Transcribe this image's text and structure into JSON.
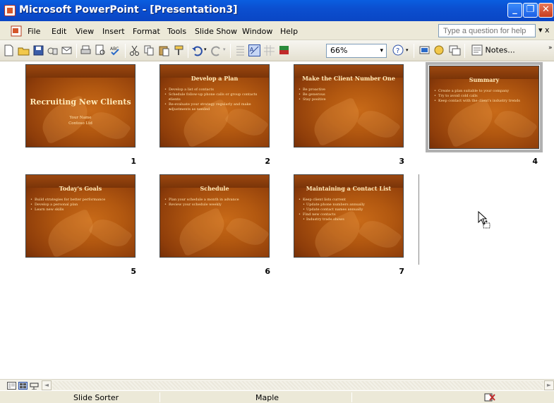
{
  "window": {
    "title": "Microsoft PowerPoint - [Presentation3]"
  },
  "menu": {
    "items": [
      "File",
      "Edit",
      "View",
      "Insert",
      "Format",
      "Tools",
      "Slide Show",
      "Window",
      "Help"
    ],
    "help_placeholder": "Type a question for help",
    "close_doc": "x"
  },
  "toolbar": {
    "zoom": "66%",
    "notes_label": "Notes..."
  },
  "slides": [
    {
      "number": "1",
      "title": "Recruiting New Clients",
      "subtitle": [
        "Your Name",
        "Contoso Ltd"
      ],
      "bullets": []
    },
    {
      "number": "2",
      "title": "Develop a Plan",
      "bullets": [
        {
          "text": "Develop a list of contacts",
          "level": 1
        },
        {
          "text": "Schedule follow-up phone calls or group contacts",
          "level": 1
        },
        {
          "text": "clients",
          "level": 2
        },
        {
          "text": "Re-evaluate your strategy regularly and make",
          "level": 1
        },
        {
          "text": "adjustments as needed",
          "level": 2
        }
      ]
    },
    {
      "number": "3",
      "title": "Make the Client Number One",
      "bullets": [
        {
          "text": "Be proactive",
          "level": 1
        },
        {
          "text": "Be generous",
          "level": 1
        },
        {
          "text": "Stay positive",
          "level": 1
        }
      ]
    },
    {
      "number": "4",
      "title": "Summary",
      "bullets": [
        {
          "text": "Create a plan suitable to your company",
          "level": 1
        },
        {
          "text": "Try to avoid cold calls",
          "level": 1
        },
        {
          "text": "Keep contact with the client's industry trends",
          "level": 1
        }
      ]
    },
    {
      "number": "5",
      "title": "Today's Goals",
      "bullets": [
        {
          "text": "Build strategies for better performance",
          "level": 1
        },
        {
          "text": "Develop a personal plan",
          "level": 1
        },
        {
          "text": "Learn new skills",
          "level": 1
        }
      ]
    },
    {
      "number": "6",
      "title": "Schedule",
      "bullets": [
        {
          "text": "Plan your schedule a month in advance",
          "level": 1
        },
        {
          "text": "Review your schedule weekly",
          "level": 1
        }
      ]
    },
    {
      "number": "7",
      "title": "Maintaining a Contact List",
      "bullets": [
        {
          "text": "Keep client lists current",
          "level": 1
        },
        {
          "text": "Update phone numbers annually",
          "level": 2
        },
        {
          "text": "Update contact names annually",
          "level": 2
        },
        {
          "text": "Find new contacts",
          "level": 1
        },
        {
          "text": "Industry trade shows",
          "level": 2
        }
      ]
    }
  ],
  "selected_slide": "4",
  "status": {
    "view": "Slide Sorter",
    "design": "Maple"
  },
  "colors": {
    "title_blue": "#0b4fd0",
    "slide_bg": "#b25810",
    "selection": "#b0b0b0"
  }
}
